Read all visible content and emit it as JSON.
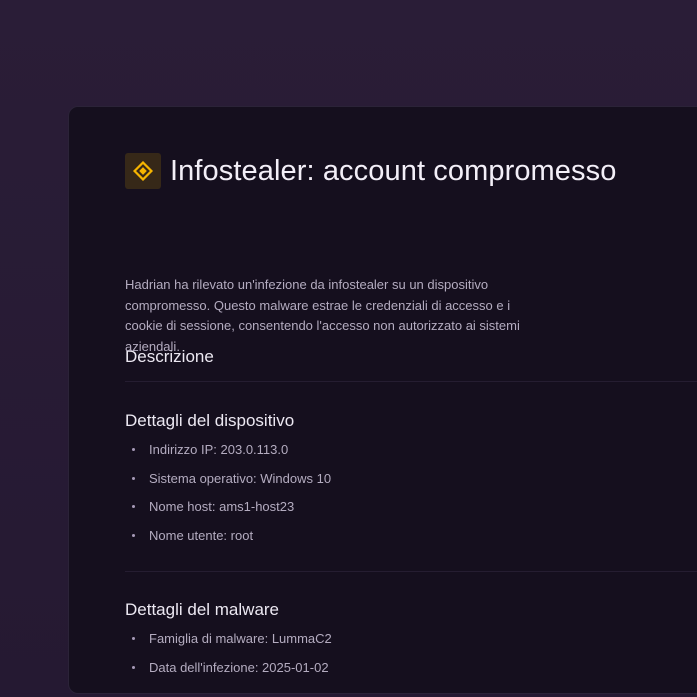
{
  "alert": {
    "title": "Infostealer: account compromesso",
    "icon": "diamond-alert-icon",
    "accent_color": "#f5b400"
  },
  "description": {
    "heading": "Descrizione",
    "text": "Hadrian ha rilevato un'infezione da infostealer su un dispositivo compromesso. Questo malware estrae le credenziali di accesso e i cookie di sessione, consentendo l'accesso non autorizzato ai sistemi aziendali."
  },
  "device_details": {
    "heading": "Dettagli del dispositivo",
    "items": [
      "Indirizzo IP: 203.0.113.0",
      "Sistema operativo: Windows 10",
      "Nome host: ams1-host23",
      "Nome utente: root"
    ]
  },
  "malware_details": {
    "heading": "Dettagli del malware",
    "items": [
      "Famiglia di malware:  LummaC2",
      "Data dell'infezione:  2025-01-02"
    ]
  }
}
